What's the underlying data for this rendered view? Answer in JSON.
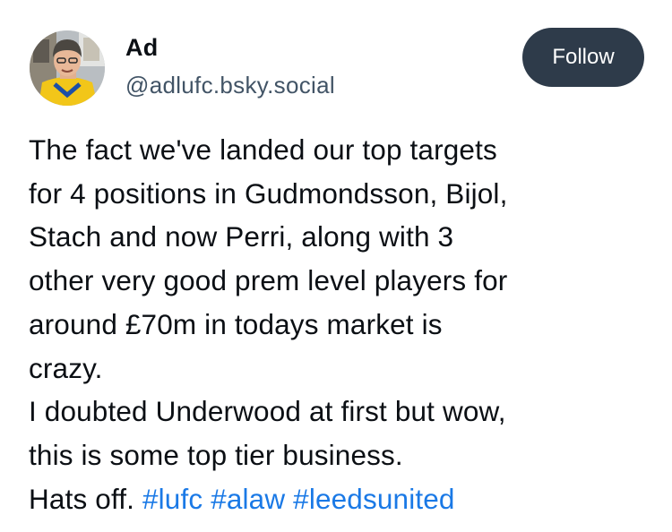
{
  "author": {
    "name": "Ad",
    "handle": "@adlufc.bsky.social"
  },
  "follow_button": {
    "label": "Follow"
  },
  "post": {
    "lines": [
      "The fact we've landed our top targets",
      "for 4 positions in Gudmondsson, Bijol,",
      "Stach and now Perri, along with 3",
      "other very good prem level players for",
      "around £70m in todays market is",
      "crazy.",
      "I doubted Underwood at first but wow,",
      "this is some top tier business."
    ],
    "last_line_prefix": "Hats off.",
    "hashtags": [
      "#lufc",
      "#alaw",
      "#leedsunited"
    ]
  },
  "colors": {
    "text": "#0b0f14",
    "handle": "#425466",
    "follow_bg": "#2e3b4a",
    "hashtag": "#1a79e6"
  },
  "icons": {
    "avatar": "user-avatar-photo"
  }
}
